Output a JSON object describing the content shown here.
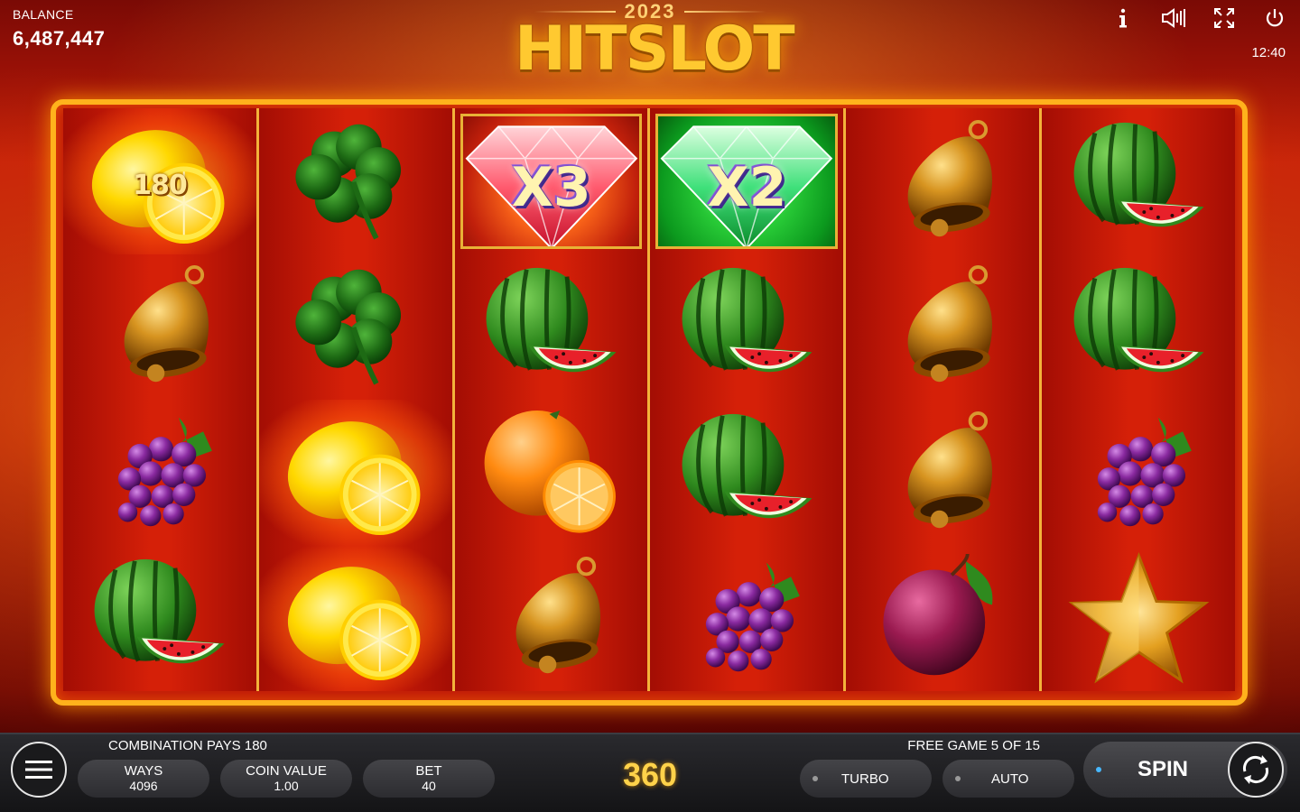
{
  "header": {
    "balance_label": "BALANCE",
    "balance_value": "6,487,447",
    "logo_year": "2023",
    "logo_title": "HITSLOT",
    "clock": "12:40",
    "icons": [
      "info-icon",
      "sound-icon",
      "fullscreen-icon",
      "power-icon"
    ]
  },
  "reels": {
    "win_amount": "180",
    "multipliers": {
      "reel3": "X3",
      "reel4": "X2"
    },
    "grid": [
      [
        "lemon",
        "bell",
        "grapes",
        "watermelon"
      ],
      [
        "clover",
        "clover",
        "lemon",
        "lemon"
      ],
      [
        "multiplier-red-diamond",
        "watermelon",
        "orange",
        "bell"
      ],
      [
        "multiplier-green-diamond",
        "watermelon",
        "watermelon",
        "grapes"
      ],
      [
        "bell",
        "bell",
        "bell",
        "plum"
      ],
      [
        "watermelon",
        "watermelon",
        "grapes",
        "star"
      ]
    ]
  },
  "footer": {
    "combination_text": "COMBINATION PAYS 180",
    "free_game_text": "FREE GAME 5 OF 15",
    "ways_label": "WAYS",
    "ways_value": "4096",
    "coin_label": "COIN VALUE",
    "coin_value": "1.00",
    "bet_label": "BET",
    "bet_value": "40",
    "total_win": "360",
    "turbo_label": "TURBO",
    "auto_label": "AUTO",
    "spin_label": "SPIN"
  },
  "colors": {
    "frame": "#ffb21c",
    "reel_bg": "#d52008",
    "win_text": "#ffd24a",
    "accent_dot": "#48b8ff"
  }
}
